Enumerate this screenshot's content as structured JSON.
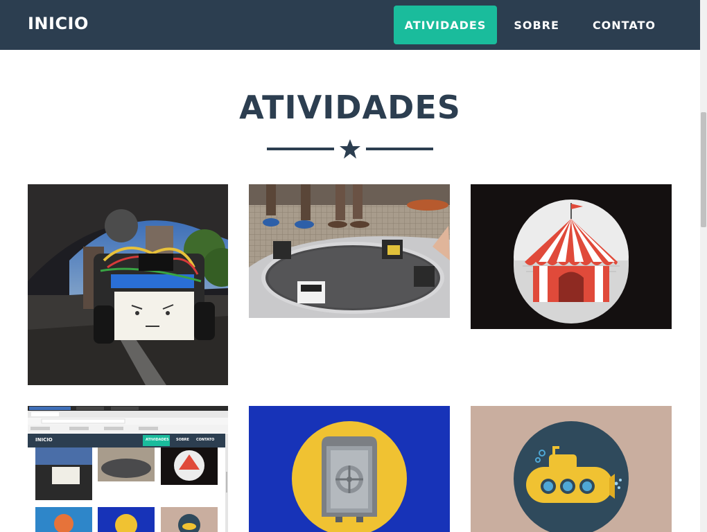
{
  "nav": {
    "brand": "INICIO",
    "links": [
      {
        "label": "ATIVIDADES",
        "active": true
      },
      {
        "label": "SOBRE",
        "active": false
      },
      {
        "label": "CONTATO",
        "active": false
      }
    ]
  },
  "section": {
    "title": "ATIVIDADES",
    "divider_icon": "star-icon"
  },
  "tiles": [
    {
      "name": "robot-photo",
      "icon": "robot-photo"
    },
    {
      "name": "sumo-arena-photo",
      "icon": "sumo-arena-photo"
    },
    {
      "name": "circus-tent-tile",
      "icon": "circus-tent-icon"
    },
    {
      "name": "site-screenshot-tile",
      "icon": "screenshot-thumbnail"
    },
    {
      "name": "safe-tile",
      "icon": "safe-icon"
    },
    {
      "name": "submarine-tile",
      "icon": "submarine-icon"
    }
  ],
  "mini_site": {
    "brand": "INICIO",
    "links": [
      "ATIVIDADES",
      "SOBRE",
      "CONTATO"
    ]
  },
  "colors": {
    "navbar": "#2c3e50",
    "accent": "#1abc9c",
    "tile_safe_bg": "#1733b8",
    "tile_circus_bg": "#141010",
    "tile_submarine_bg": "#c9ae9f"
  }
}
